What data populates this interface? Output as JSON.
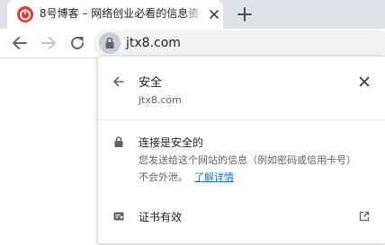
{
  "tab": {
    "title": "8号博客 – 网络创业必看的信息资"
  },
  "omnibox": {
    "url": "jtx8.com"
  },
  "page_info": {
    "title": "安全",
    "domain": "jtx8.com",
    "connection_title": "连接是安全的",
    "connection_desc": "您发送给这个网站的信息（例如密码或信用卡号）不会外泄。",
    "learn_more": "了解详情",
    "certificate_label": "证书有效"
  },
  "colors": {
    "tab_strip": "#dee1e6",
    "omnibox_bg": "#f1f3f4",
    "link": "#1a73e8",
    "favicon_red": "#e5372f"
  },
  "icons": {
    "favicon": "red-power-logo",
    "tab_close": "close-icon",
    "new_tab": "plus-icon",
    "back": "arrow-left-icon",
    "forward": "arrow-right-icon",
    "reload": "reload-icon",
    "lock": "lock-icon",
    "certificate": "certificate-icon",
    "external": "external-link-icon"
  }
}
